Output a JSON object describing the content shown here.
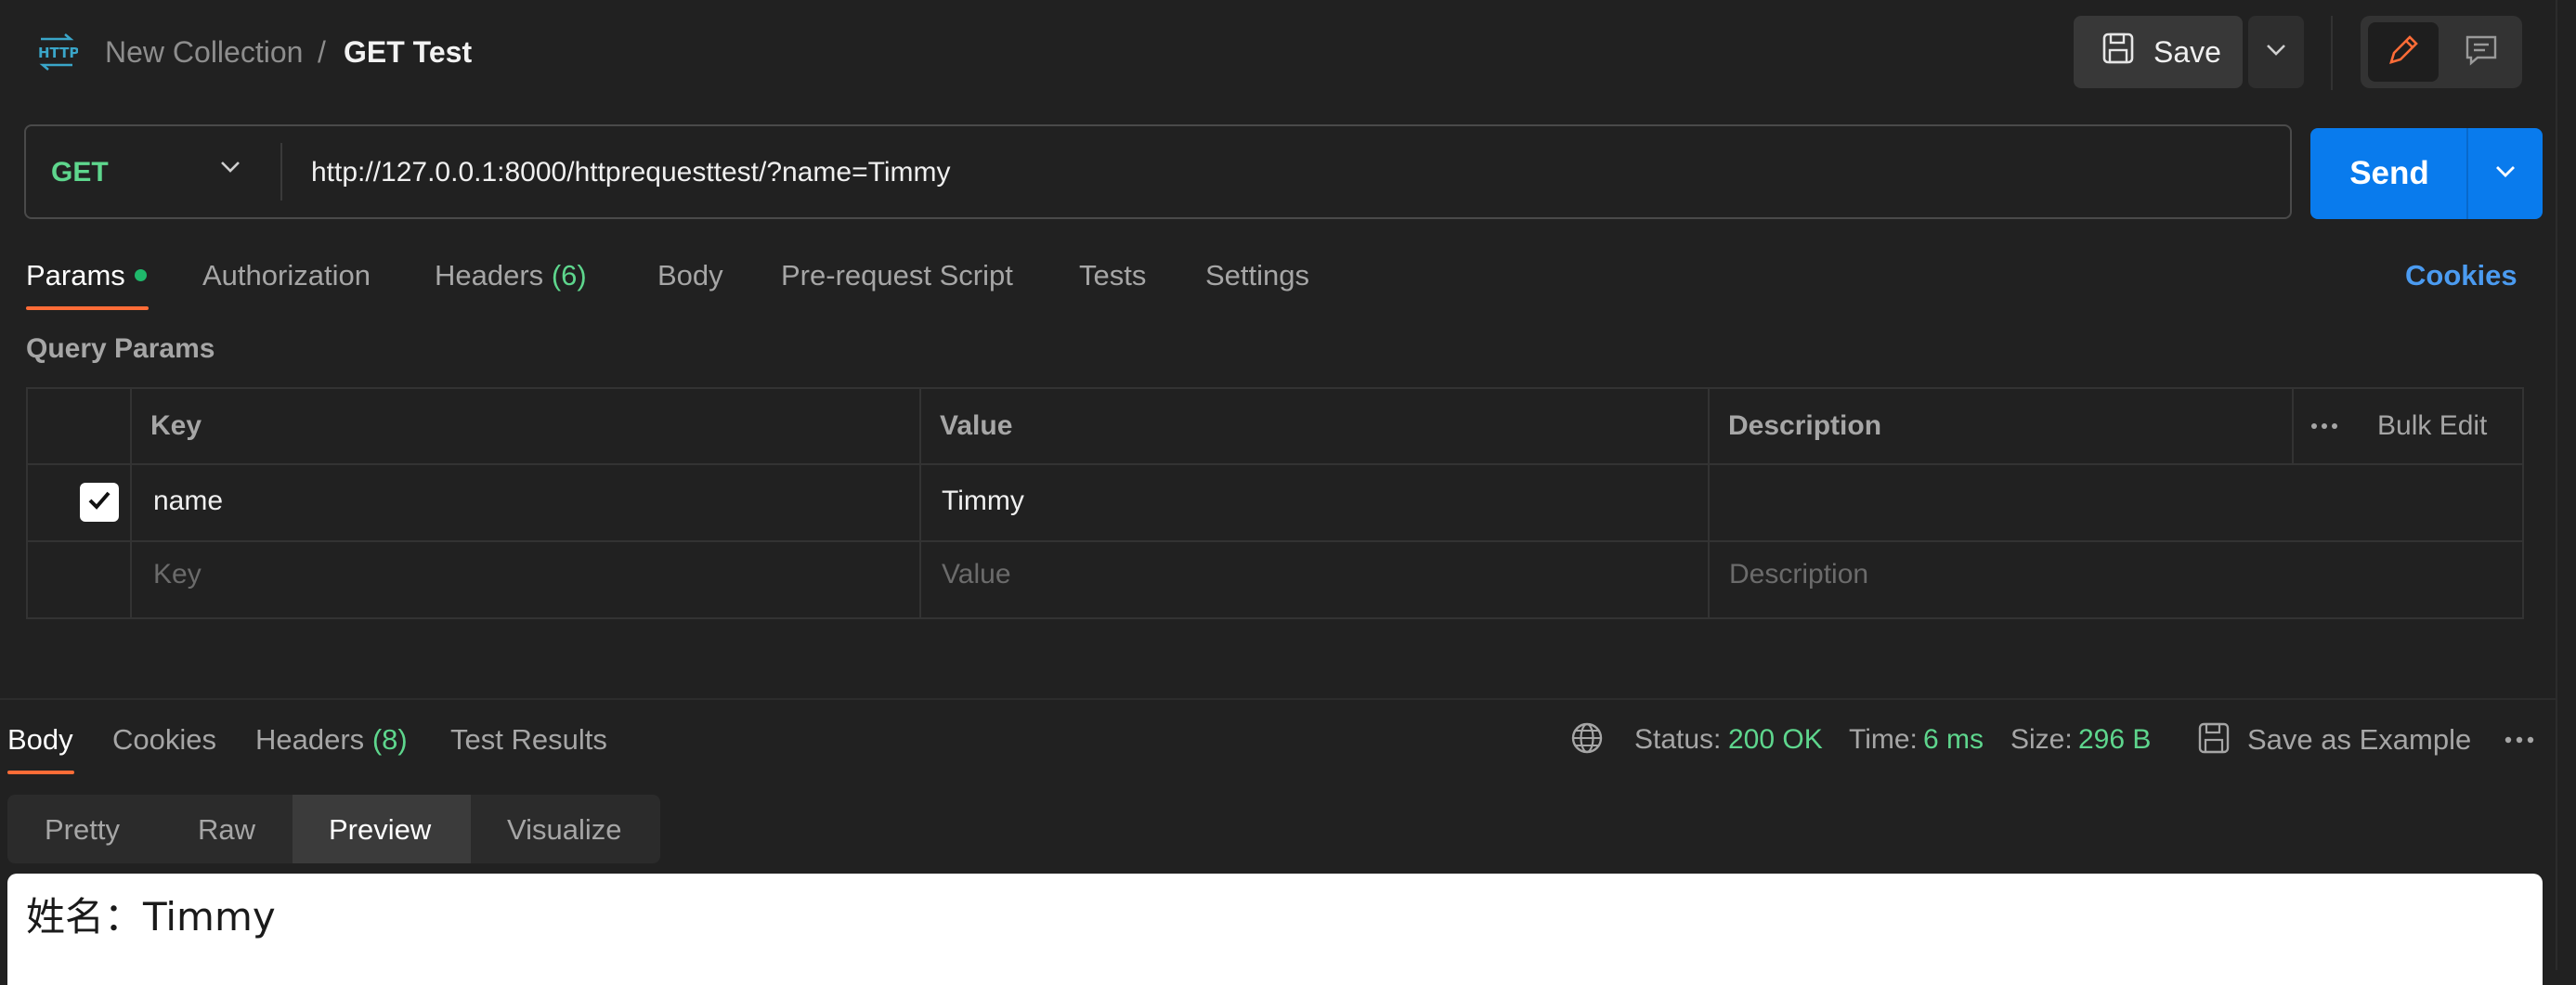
{
  "header": {
    "protocol_icon": "http-icon",
    "collection": "New Collection",
    "separator": "/",
    "request_name": "GET Test",
    "save_label": "Save"
  },
  "request": {
    "method": "GET",
    "url": "http://127.0.0.1:8000/httprequesttest/?name=Timmy",
    "send_label": "Send"
  },
  "tabs": {
    "params": "Params",
    "authorization": "Authorization",
    "headers": "Headers",
    "headers_count": "(6)",
    "body": "Body",
    "prerequest": "Pre-request Script",
    "tests": "Tests",
    "settings": "Settings",
    "cookies": "Cookies"
  },
  "query_params": {
    "title": "Query Params",
    "columns": {
      "key": "Key",
      "value": "Value",
      "description": "Description"
    },
    "bulk_edit": "Bulk Edit",
    "rows": [
      {
        "checked": true,
        "key": "name",
        "value": "Timmy",
        "description": ""
      }
    ],
    "placeholders": {
      "key": "Key",
      "value": "Value",
      "description": "Description"
    }
  },
  "response": {
    "tabs": {
      "body": "Body",
      "cookies": "Cookies",
      "headers": "Headers",
      "headers_count": "(8)",
      "test_results": "Test Results"
    },
    "status_label": "Status:",
    "status_value": "200 OK",
    "time_label": "Time:",
    "time_value": "6 ms",
    "size_label": "Size:",
    "size_value": "296 B",
    "save_example": "Save as Example",
    "view_modes": [
      "Pretty",
      "Raw",
      "Preview",
      "Visualize"
    ],
    "active_view": "Preview",
    "preview_text": "姓名：Timmy"
  },
  "colors": {
    "background": "#212121",
    "accent_orange": "#ff6c37",
    "send_blue": "#097bed",
    "success_green": "#5ed68d",
    "link_blue": "#4b9bf0"
  }
}
